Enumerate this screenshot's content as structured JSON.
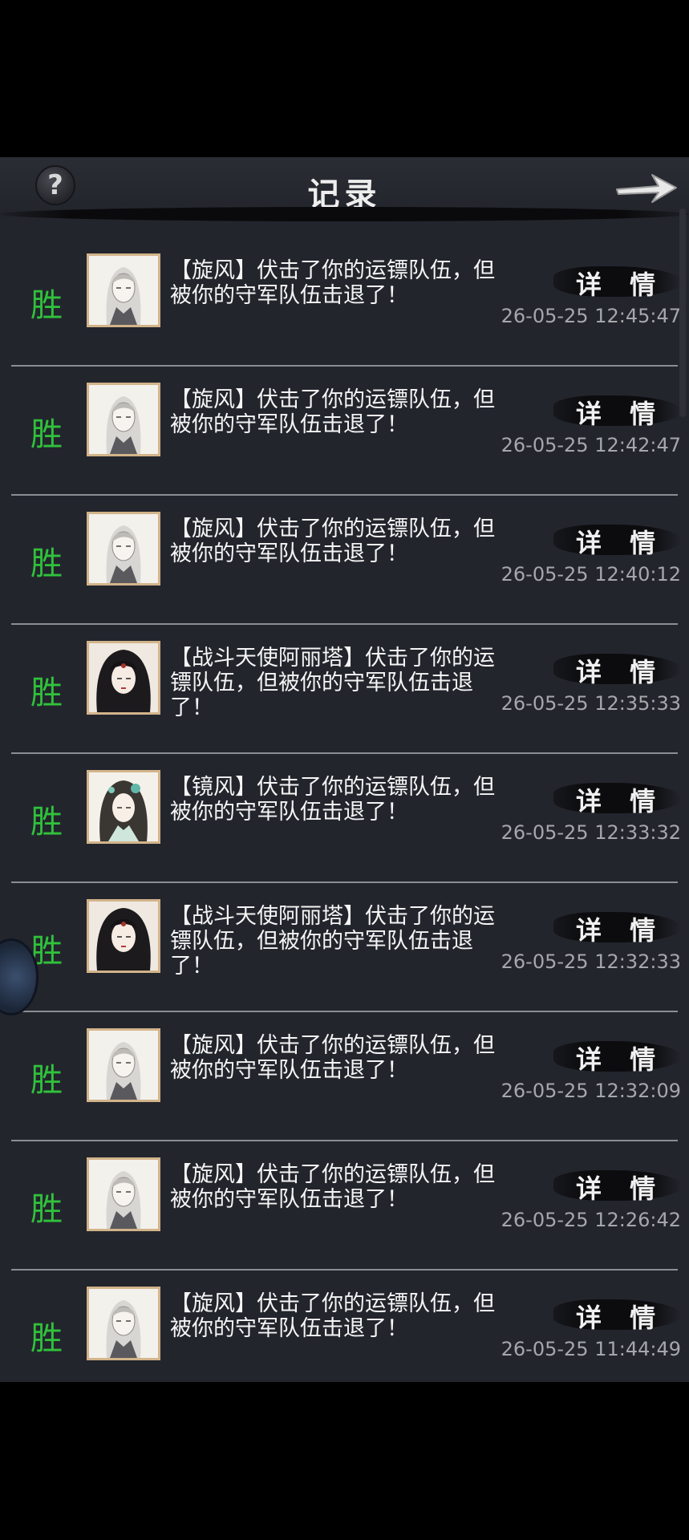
{
  "header": {
    "title": "记录",
    "help_icon": "?"
  },
  "colors": {
    "win": "#30c23b",
    "panel": "#23252d",
    "avatar_border": "#d2b48a"
  },
  "detail_label": "详 情",
  "records": [
    {
      "result": "胜",
      "avatar": "white-hair-male",
      "message": "【旋风】伏击了你的运镖队伍，但被你的守军队伍击退了！",
      "time": "26-05-25 12:45:47"
    },
    {
      "result": "胜",
      "avatar": "white-hair-male",
      "message": "【旋风】伏击了你的运镖队伍，但被你的守军队伍击退了！",
      "time": "26-05-25 12:42:47"
    },
    {
      "result": "胜",
      "avatar": "white-hair-male",
      "message": "【旋风】伏击了你的运镖队伍，但被你的守军队伍击退了！",
      "time": "26-05-25 12:40:12"
    },
    {
      "result": "胜",
      "avatar": "dark-hair-female",
      "message": "【战斗天使阿丽塔】伏击了你的运镖队伍，但被你的守军队伍击退了！",
      "time": "26-05-25 12:35:33"
    },
    {
      "result": "胜",
      "avatar": "jade-female",
      "message": "【镜风】伏击了你的运镖队伍，但被你的守军队伍击退了！",
      "time": "26-05-25 12:33:32"
    },
    {
      "result": "胜",
      "avatar": "dark-hair-female",
      "message": "【战斗天使阿丽塔】伏击了你的运镖队伍，但被你的守军队伍击退了！",
      "time": "26-05-25 12:32:33"
    },
    {
      "result": "胜",
      "avatar": "white-hair-male",
      "message": "【旋风】伏击了你的运镖队伍，但被你的守军队伍击退了！",
      "time": "26-05-25 12:32:09"
    },
    {
      "result": "胜",
      "avatar": "white-hair-male",
      "message": "【旋风】伏击了你的运镖队伍，但被你的守军队伍击退了！",
      "time": "26-05-25 12:26:42"
    },
    {
      "result": "胜",
      "avatar": "white-hair-male",
      "message": "【旋风】伏击了你的运镖队伍，但被你的守军队伍击退了！",
      "time": "26-05-25 11:44:49"
    }
  ]
}
